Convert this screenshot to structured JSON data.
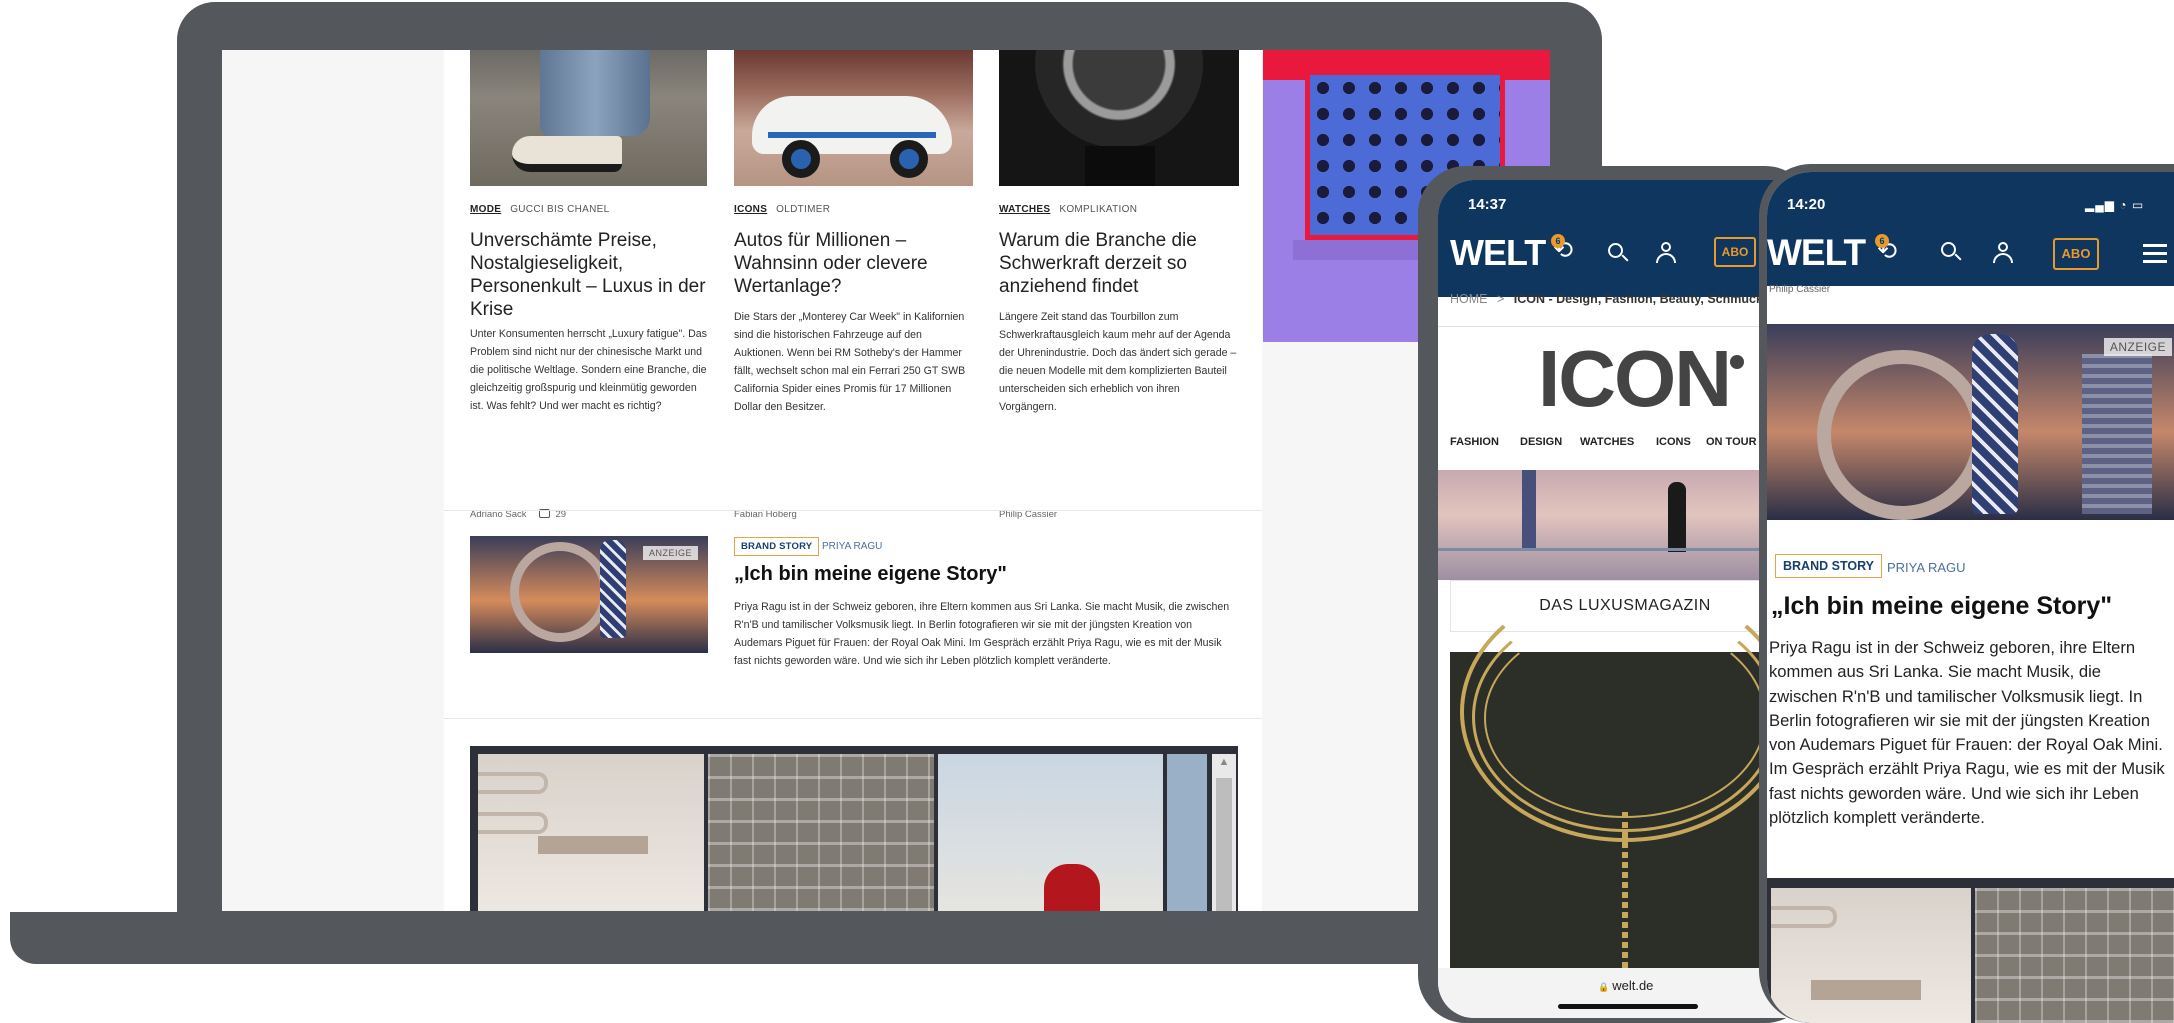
{
  "laptop": {
    "articles": [
      {
        "category": "MODE",
        "subcategory": "GUCCI BIS CHANEL",
        "headline": "Unverschämte Preise, Nostalgieseligkeit, Personenkult – Luxus in der Krise",
        "teaser": "Unter Konsumenten herrscht „Luxury fatigue\". Das Problem sind nicht nur der chinesische Markt und die politische Weltlage. Sondern eine Branche, die gleichzeitig großspurig und kleinmütig geworden ist. Was fehlt? Und wer macht es richtig?",
        "author": "Adriano Sack",
        "comments": "29"
      },
      {
        "category": "ICONS",
        "subcategory": "OLDTIMER",
        "headline": "Autos für Millionen – Wahnsinn oder clevere Wertanlage?",
        "teaser": "Die Stars der „Monterey Car Week\" in Kalifornien sind die historischen Fahrzeuge auf den Auktionen. Wenn bei RM Sotheby's der Hammer fällt, wechselt schon mal ein Ferrari 250 GT SWB California Spider eines Promis für 17 Millionen Dollar den Besitzer.",
        "author": "Fabian Hoberg"
      },
      {
        "category": "WATCHES",
        "subcategory": "KOMPLIKATION",
        "headline": "Warum die Branche die Schwerkraft derzeit so anziehend findet",
        "teaser": "Längere Zeit stand das Tourbillon zum Schwerkraftausgleich kaum mehr auf der Agenda der Uhrenindustrie. Doch das ändert sich gerade – die neuen Modelle mit dem komplizierten Bauteil unterscheiden sich erheblich von ihren Vorgängern.",
        "author": "Philip Cassier"
      }
    ],
    "brand_story": {
      "ad_label": "ANZEIGE",
      "badge": "BRAND STORY",
      "sponsor": "PRIYA RAGU",
      "headline": "„Ich bin meine eigene Story\"",
      "teaser": "Priya Ragu ist in der Schweiz geboren, ihre Eltern kommen aus Sri Lanka. Sie macht Musik, die zwischen R'n'B und tamilischer Volksmusik liegt. In Berlin fotografieren wir sie mit der jüngsten Kreation von Audemars Piguet für Frauen: der Royal Oak Mini. Im Gespräch erzählt Priya Ragu, wie es mit der Musik fast nichts geworden wäre. Und wie sich ihr Leben plötzlich komplett veränderte."
    }
  },
  "tablet": {
    "time": "14:37",
    "logo": "WELT",
    "notification_count": "6",
    "abo_label": "ABO",
    "breadcrumb": {
      "home": "HOME",
      "separator": ">",
      "current": "ICON - Design, Fashion, Beauty, Schmuck u"
    },
    "section_logo": "ICON",
    "nav": [
      "FASHION",
      "DESIGN",
      "WATCHES",
      "ICONS",
      "ON TOUR"
    ],
    "magazine_label": "DAS LUXUSMAGAZIN",
    "url": "welt.de",
    "lock_glyph": "🔒"
  },
  "phone": {
    "time": "14:20",
    "logo": "WELT",
    "notification_count": "6",
    "abo_label": "ABO",
    "caption": "Philip Cassier",
    "ad_label": "ANZEIGE",
    "badge": "BRAND STORY",
    "sponsor": "PRIYA RAGU",
    "headline": "„Ich bin meine eigene Story\"",
    "body": "Priya Ragu ist in der Schweiz geboren, ihre Eltern kommen aus Sri Lanka. Sie macht Musik, die zwischen R'n'B und tamilischer Volksmusik liegt. In Berlin fotografieren wir sie mit der jüngsten Kreation von Audemars Piguet für Frauen: der Royal Oak Mini. Im Gespräch erzählt Priya Ragu, wie es mit der Musik fast nichts geworden wäre. Und wie sich ihr Leben plötzlich komplett veränderte."
  },
  "glyphs": {
    "clock": "⟲",
    "up_arrow": "▲",
    "signal": "▂▄▆ ◔ ▭"
  },
  "colors": {
    "header_navy": "#0f365e",
    "accent_orange": "#e89a2b",
    "device_gray": "#54575c"
  }
}
